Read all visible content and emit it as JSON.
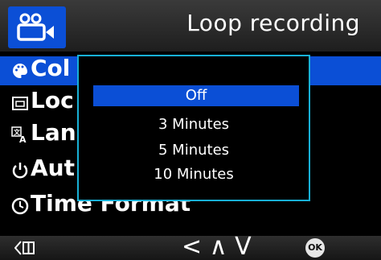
{
  "header": {
    "title": "Loop recording",
    "mode_icon": "camcorder-icon"
  },
  "menu": {
    "items": [
      {
        "label": "Col",
        "icon": "palette-icon"
      },
      {
        "label": "Loc",
        "icon": "lock-icon"
      },
      {
        "label": "Lan",
        "icon": "language-icon"
      },
      {
        "label": "Aut",
        "icon": "power-icon"
      },
      {
        "label": "Time Format",
        "icon": "clock-icon"
      }
    ]
  },
  "popup": {
    "options": [
      "Off",
      "3 Minutes",
      "5 Minutes",
      "10 Minutes"
    ],
    "selected": "Off"
  },
  "footer": {
    "nav_label": "< ∧ V",
    "ok_label": "OK",
    "back_icon": "back-icon"
  },
  "colors": {
    "accent": "#0b4fd6",
    "popup_border": "#18b0d6"
  }
}
